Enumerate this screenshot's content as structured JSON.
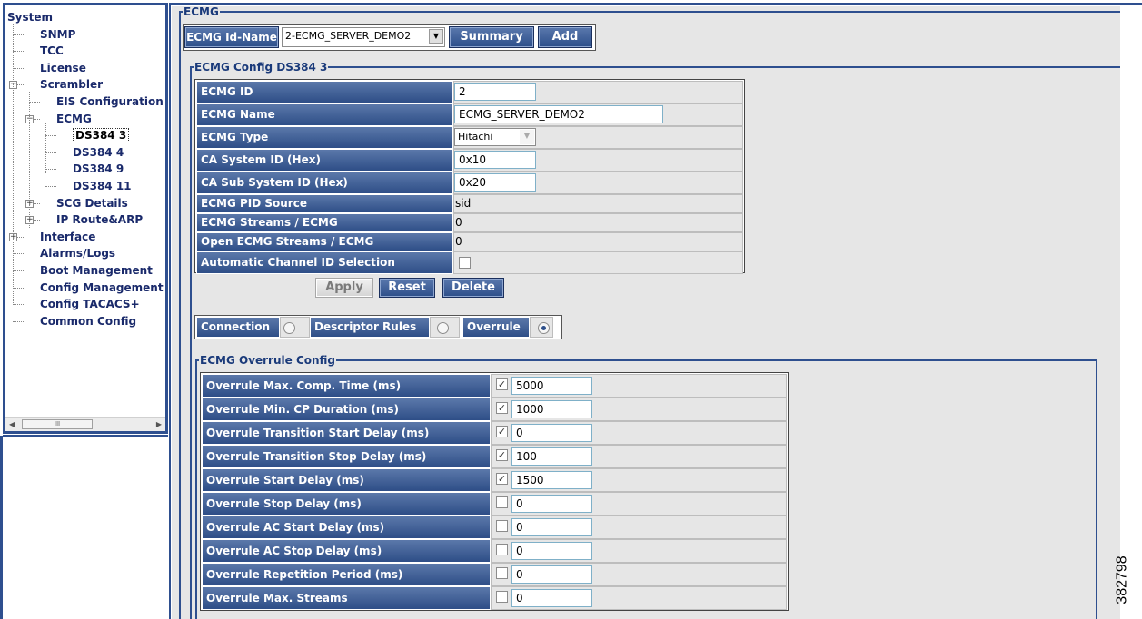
{
  "tree": {
    "items": [
      {
        "label": "System",
        "level": 0
      },
      {
        "label": "SNMP",
        "level": 1
      },
      {
        "label": "TCC",
        "level": 1
      },
      {
        "label": "License",
        "level": 1
      },
      {
        "label": "Scrambler",
        "level": 1,
        "expander": "minus"
      },
      {
        "label": "EIS Configuration",
        "level": 2
      },
      {
        "label": "ECMG",
        "level": 2,
        "expander": "minus"
      },
      {
        "label": "DS384 3",
        "level": 3,
        "selected": true
      },
      {
        "label": "DS384 4",
        "level": 3
      },
      {
        "label": "DS384 9",
        "level": 3
      },
      {
        "label": "DS384 11",
        "level": 3
      },
      {
        "label": "SCG Details",
        "level": 2,
        "expander": "plus"
      },
      {
        "label": "IP Route&ARP",
        "level": 2,
        "expander": "plus"
      },
      {
        "label": "Interface",
        "level": 1,
        "expander": "plus"
      },
      {
        "label": "Alarms/Logs",
        "level": 1
      },
      {
        "label": "Boot Management",
        "level": 1
      },
      {
        "label": "Config Management",
        "level": 1
      },
      {
        "label": "Config TACACS+",
        "level": 1
      },
      {
        "label": "Common Config",
        "level": 1
      }
    ],
    "scroll_thumb": "III"
  },
  "ecmg": {
    "legend": "ECMG",
    "id_name_label": "ECMG Id-Name",
    "id_name_value": "2-ECMG_SERVER_DEMO2",
    "summary_button": "Summary",
    "add_button": "Add"
  },
  "config": {
    "legend": "ECMG Config DS384 3",
    "rows": [
      {
        "label": "ECMG ID",
        "value": "2",
        "kind": "input"
      },
      {
        "label": "ECMG Name",
        "value": "ECMG_SERVER_DEMO2",
        "kind": "input"
      },
      {
        "label": "ECMG Type",
        "value": "Hitachi",
        "kind": "select"
      },
      {
        "label": "CA System ID (Hex)",
        "value": "0x10",
        "kind": "input"
      },
      {
        "label": "CA Sub System ID (Hex)",
        "value": "0x20",
        "kind": "input"
      },
      {
        "label": "ECMG PID Source",
        "value": "sid",
        "kind": "text"
      },
      {
        "label": "ECMG Streams / ECMG",
        "value": "0",
        "kind": "text"
      },
      {
        "label": "Open ECMG Streams / ECMG",
        "value": "0",
        "kind": "text"
      },
      {
        "label": "Automatic Channel ID Selection",
        "value": "",
        "kind": "checkbox",
        "checked": false
      }
    ],
    "apply_button": "Apply",
    "reset_button": "Reset",
    "delete_button": "Delete"
  },
  "mode_tabs": [
    {
      "label": "Connection",
      "selected": false
    },
    {
      "label": "Descriptor Rules",
      "selected": false
    },
    {
      "label": "Overrule",
      "selected": true
    }
  ],
  "overrule": {
    "legend": "ECMG Overrule Config",
    "rows": [
      {
        "label": "Overrule Max. Comp. Time (ms)",
        "checked": true,
        "value": "5000"
      },
      {
        "label": "Overrule Min. CP Duration (ms)",
        "checked": true,
        "value": "1000"
      },
      {
        "label": "Overrule Transition Start Delay (ms)",
        "checked": true,
        "value": "0"
      },
      {
        "label": "Overrule Transition Stop Delay (ms)",
        "checked": true,
        "value": "100"
      },
      {
        "label": "Overrule Start Delay (ms)",
        "checked": true,
        "value": "1500"
      },
      {
        "label": "Overrule Stop Delay (ms)",
        "checked": false,
        "value": "0"
      },
      {
        "label": "Overrule AC Start Delay (ms)",
        "checked": false,
        "value": "0"
      },
      {
        "label": "Overrule AC Stop Delay (ms)",
        "checked": false,
        "value": "0"
      },
      {
        "label": "Overrule Repetition Period (ms)",
        "checked": false,
        "value": "0"
      },
      {
        "label": "Overrule Max. Streams",
        "checked": false,
        "value": "0"
      }
    ]
  },
  "figure_id": "382798",
  "colors": {
    "accent": "#2e4f8f",
    "button": "#3c5d96",
    "panel_bg": "#e6e6e6"
  }
}
